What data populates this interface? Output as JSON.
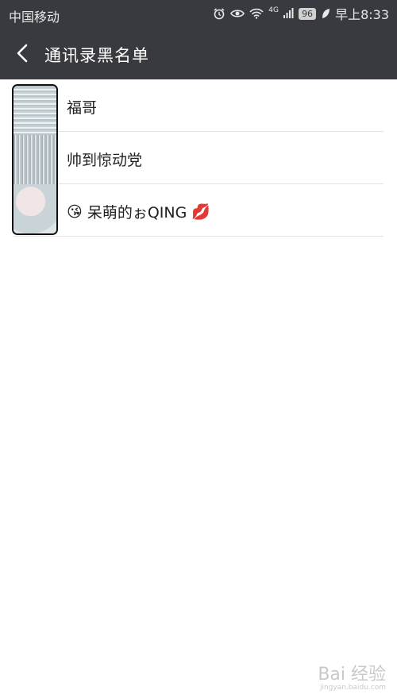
{
  "status": {
    "carrier": "中国移动",
    "network": "4G",
    "battery": "96",
    "time": "早上8:33"
  },
  "header": {
    "title": "通讯录黑名单"
  },
  "contacts": [
    {
      "name": "福哥"
    },
    {
      "name": "帅到惊动党"
    },
    {
      "name_prefix_emoji": "😘",
      "name": "呆萌的ぉQING",
      "name_suffix_emoji": "💋"
    }
  ],
  "watermark": {
    "text": "Bai 经验",
    "sub": "jingyan.baidu.com"
  }
}
